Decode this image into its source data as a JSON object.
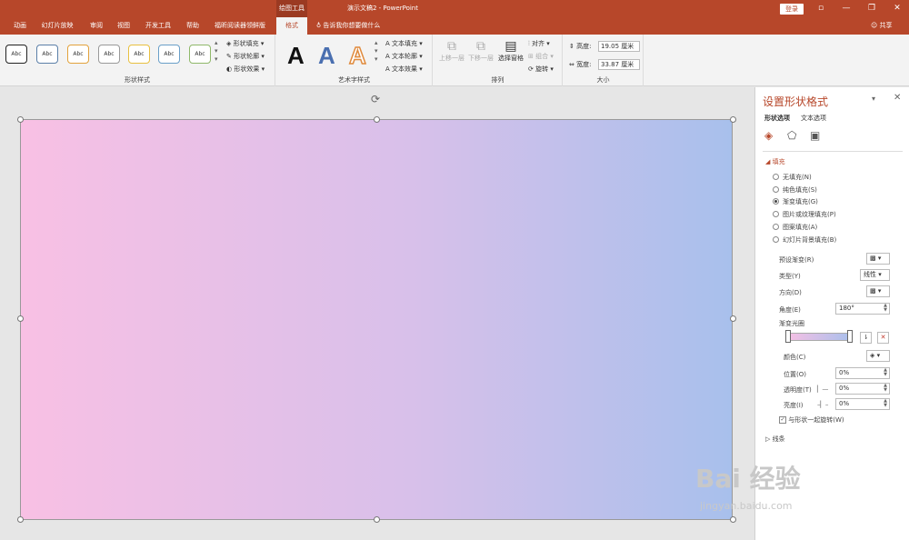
{
  "window": {
    "context_title": "绘图工具",
    "app_title": "演示文稿2 - PowerPoint",
    "login_label": "登录",
    "restore_glyph": "▫",
    "minimize_glyph": "—",
    "maximize_glyph": "❐",
    "close_glyph": "✕"
  },
  "tabs": [
    {
      "label": "动画"
    },
    {
      "label": "幻灯片放映"
    },
    {
      "label": "审阅"
    },
    {
      "label": "视图"
    },
    {
      "label": "开发工具"
    },
    {
      "label": "帮助"
    },
    {
      "label": "福昕阅读器领鲜版"
    },
    {
      "label": "格式"
    }
  ],
  "tell_me": "告诉我你想要做什么",
  "share_label": "共享",
  "ribbon": {
    "shape_styles": {
      "label": "形状样式",
      "samples": [
        "Abc",
        "Abc",
        "Abc",
        "Abc",
        "Abc",
        "Abc",
        "Abc"
      ],
      "fill": "形状填充",
      "outline": "形状轮廓",
      "effect": "形状效果"
    },
    "wordart": {
      "label": "艺术字样式",
      "letter": "A",
      "text_fill": "文本填充",
      "text_outline": "文本轮廓",
      "text_effect": "文本效果"
    },
    "arrange": {
      "label": "排列",
      "bring_forward": "上移一层",
      "send_backward": "下移一层",
      "selection_pane": "选择窗格",
      "align": "对齐",
      "group": "组合",
      "rotate": "旋转"
    },
    "size": {
      "label": "大小",
      "height_label": "高度:",
      "height_value": "19.05 厘米",
      "width_label": "宽度:",
      "width_value": "33.87 厘米"
    }
  },
  "pane": {
    "title": "设置形状格式",
    "tab_shape": "形状选项",
    "tab_text": "文本选项",
    "fill_section": "填充",
    "fill_options": [
      {
        "label": "无填充(N)",
        "selected": false
      },
      {
        "label": "纯色填充(S)",
        "selected": false
      },
      {
        "label": "渐变填充(G)",
        "selected": true
      },
      {
        "label": "图片或纹理填充(P)",
        "selected": false
      },
      {
        "label": "图案填充(A)",
        "selected": false
      },
      {
        "label": "幻灯片背景填充(B)",
        "selected": false
      }
    ],
    "preset_label": "预设渐变(R)",
    "type_label": "类型(Y)",
    "type_value": "线性",
    "direction_label": "方向(D)",
    "angle_label": "角度(E)",
    "angle_value": "180°",
    "stops_label": "渐变光圈",
    "color_label": "颜色(C)",
    "position_label": "位置(O)",
    "position_value": "0%",
    "transparency_label": "透明度(T)",
    "transparency_value": "0%",
    "brightness_label": "亮度(I)",
    "brightness_value": "0%",
    "rotate_with_shape": "与形状一起旋转(W)",
    "line_section": "线条"
  },
  "colors": {
    "accent": "#b7472a",
    "gradient_start": "#f8c0e4",
    "gradient_end": "#a8c0ec"
  },
  "watermark": {
    "brand": "Bai 经验",
    "url": "jingyan.baidu.com"
  }
}
